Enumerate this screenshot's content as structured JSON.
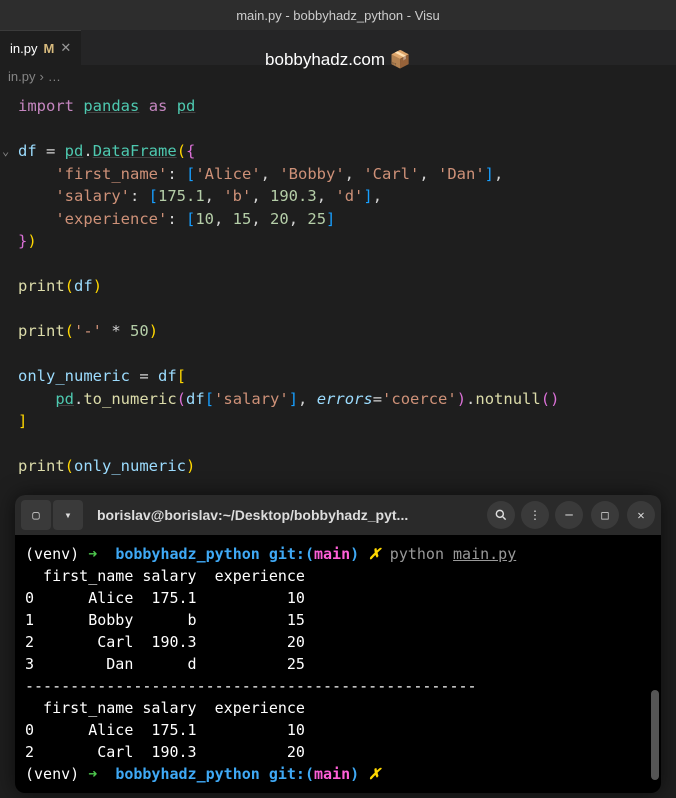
{
  "window": {
    "title": "main.py - bobbyhadz_python - Visu"
  },
  "tab": {
    "name": "in.py",
    "modified": "M"
  },
  "banner": "bobbyhadz.com 📦",
  "breadcrumb": {
    "file": "in.py",
    "sep": "›",
    "more": "…"
  },
  "code": {
    "l1_import": "import",
    "l1_pandas": "pandas",
    "l1_as": "as",
    "l1_pd": "pd",
    "l3_df": "df",
    "l3_eq": " = ",
    "l3_pd": "pd",
    "l3_dataframe": "DataFrame",
    "l4_key": "'first_name'",
    "l4_v1": "'Alice'",
    "l4_v2": "'Bobby'",
    "l4_v3": "'Carl'",
    "l4_v4": "'Dan'",
    "l5_key": "'salary'",
    "l5_v1": "175.1",
    "l5_v2": "'b'",
    "l5_v3": "190.3",
    "l5_v4": "'d'",
    "l6_key": "'experience'",
    "l6_v1": "10",
    "l6_v2": "15",
    "l6_v3": "20",
    "l6_v4": "25",
    "l8_print": "print",
    "l8_arg": "df",
    "l9_print": "print",
    "l9_str": "'-'",
    "l9_star": " * ",
    "l9_num": "50",
    "l10_var": "only_numeric",
    "l10_eq": " = ",
    "l10_df": "df",
    "l11_pd": "pd",
    "l11_tonum": "to_numeric",
    "l11_df": "df",
    "l11_col": "'salary'",
    "l11_errors": "errors",
    "l11_coerce": "'coerce'",
    "l11_notnull": "notnull",
    "l13_print": "print",
    "l13_arg": "only_numeric"
  },
  "terminal": {
    "title": "borislav@borislav:~/Desktop/bobbyhadz_pyt...",
    "venv": "(venv)",
    "arrow": "➜",
    "path": "bobbyhadz_python",
    "git": "git:(",
    "branch": "main",
    "gitclose": ")",
    "x": "✗",
    "cmd": "python",
    "file": "main.py",
    "out1": "  first_name salary  experience",
    "out2": "0      Alice  175.1          10",
    "out3": "1      Bobby      b          15",
    "out4": "2       Carl  190.3          20",
    "out5": "3        Dan      d          25",
    "out6": "--------------------------------------------------",
    "out7": "  first_name salary  experience",
    "out8": "0      Alice  175.1          10",
    "out9": "2       Carl  190.3          20"
  }
}
